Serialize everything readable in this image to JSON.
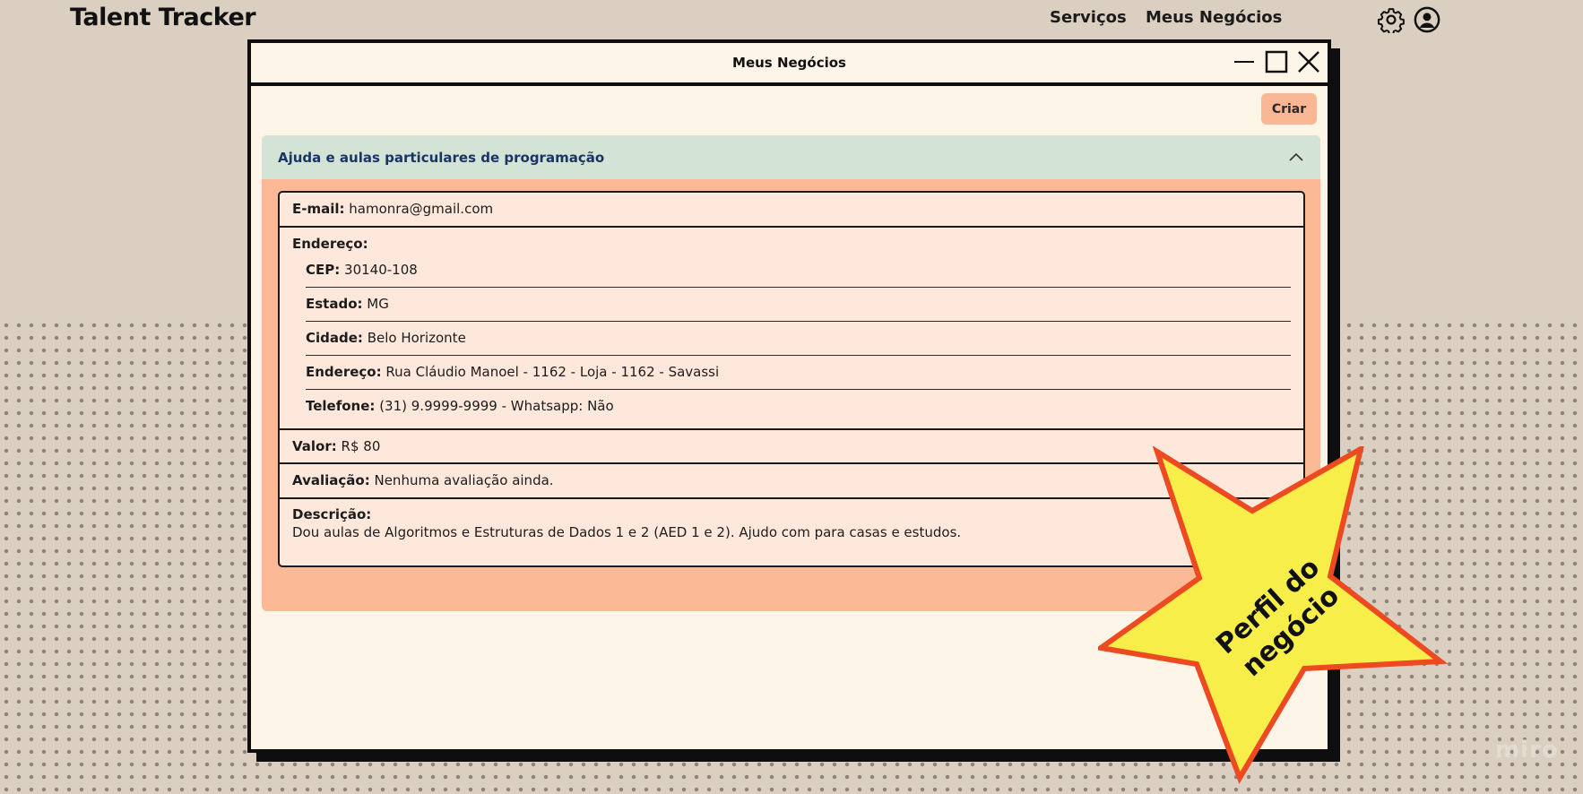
{
  "app": {
    "brand": "Talent Tracker"
  },
  "nav": {
    "servicos": "Serviços",
    "meus_negocios": "Meus Negócios"
  },
  "window": {
    "title": "Meus Negócios",
    "criar_label": "Criar"
  },
  "business": {
    "title": "Ajuda e aulas particulares de programação",
    "email_label": "E-mail:",
    "email": "hamonra@gmail.com",
    "endereco_label": "Endereço:",
    "cep_label": "CEP:",
    "cep": "30140-108",
    "estado_label": "Estado:",
    "estado": "MG",
    "cidade_label": "Cidade:",
    "cidade": "Belo Horizonte",
    "rua_label": "Endereço:",
    "rua": "Rua Cláudio Manoel - 1162 - Loja - 1162 - Savassi",
    "telefone_label": "Telefone:",
    "telefone": "(31) 9.9999-9999 - Whatsapp: Não",
    "valor_label": "Valor:",
    "valor": "R$ 80",
    "avaliacao_label": "Avaliação:",
    "avaliacao": "Nenhuma avaliação ainda.",
    "descricao_label": "Descrição:",
    "descricao": "Dou aulas de Algoritmos e Estruturas de Dados 1 e 2 (AED 1 e 2). Ajudo com para casas e estudos."
  },
  "annotation": {
    "line1": "Perfil do",
    "line2": "negócio",
    "fill": "#f7ee4a",
    "stroke": "#ee4a22"
  },
  "watermark": "miro",
  "icons": [
    "gear-icon",
    "user-icon",
    "minimize-icon",
    "maximize-icon",
    "close-icon",
    "chevron-up-icon"
  ]
}
